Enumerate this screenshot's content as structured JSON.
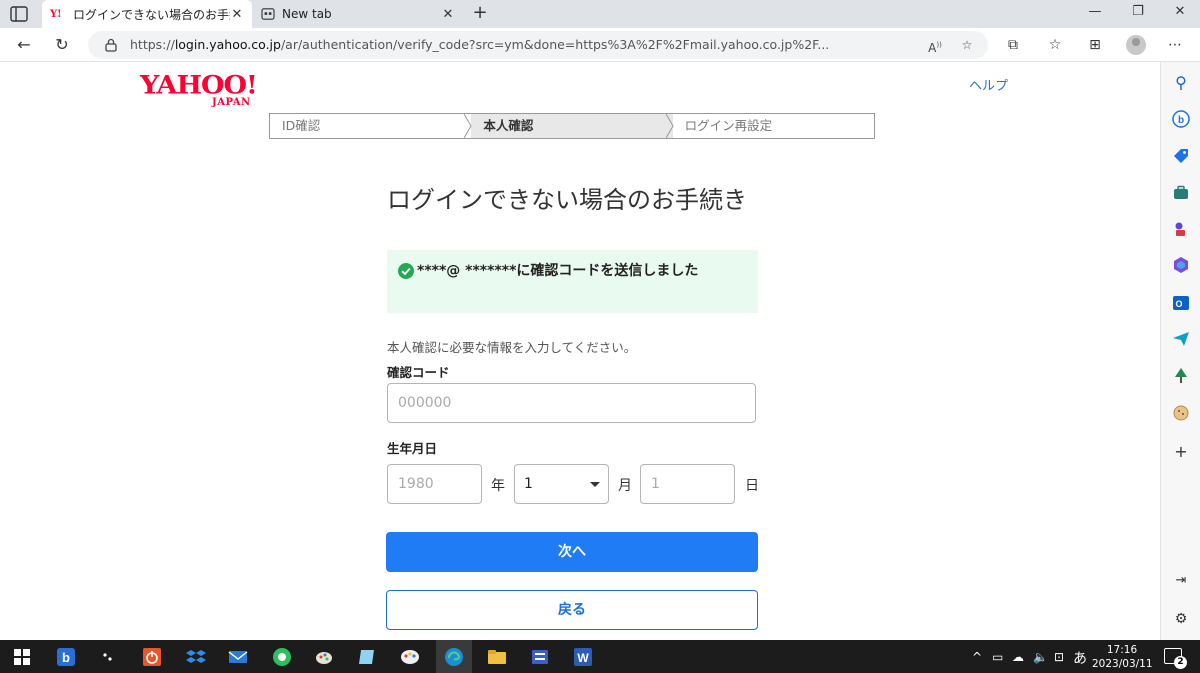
{
  "browser": {
    "tabs": [
      {
        "title": "ログインできない場合のお手続き - Yahoo! JAPAN",
        "favicon": "Y!",
        "active": true
      },
      {
        "title": "New tab",
        "active": false
      }
    ],
    "url_prefix": "https://",
    "url_host": "login.yahoo.co.jp",
    "url_rest": "/ar/authentication/verify_code?src=ym&done=https%3A%2F%2Fmail.yahoo.co.jp%2F..."
  },
  "header": {
    "logo_main": "YAHOO!",
    "logo_sub": "JAPAN",
    "help_label": "ヘルプ"
  },
  "steps": [
    "ID確認",
    "本人確認",
    "ログイン再設定"
  ],
  "page": {
    "title": "ログインできない場合のお手続き",
    "notice": "****@ *******に確認コードを送信しました",
    "description": "本人確認に必要な情報を入力してください。"
  },
  "form": {
    "code_label": "確認コード",
    "code_placeholder": "000000",
    "birth_label": "生年月日",
    "year_placeholder": "1980",
    "year_unit": "年",
    "month_value": "1",
    "month_unit": "月",
    "day_placeholder": "1",
    "day_unit": "日",
    "next_label": "次へ",
    "back_label": "戻る"
  },
  "taskbar": {
    "ime": "あ",
    "time": "17:16",
    "date": "2023/03/11",
    "notifications": "2"
  },
  "colors": {
    "brand_red": "#ff0033",
    "primary_blue": "#1f7cf4",
    "notice_bg": "#e9faf0",
    "success_green": "#27a856"
  }
}
